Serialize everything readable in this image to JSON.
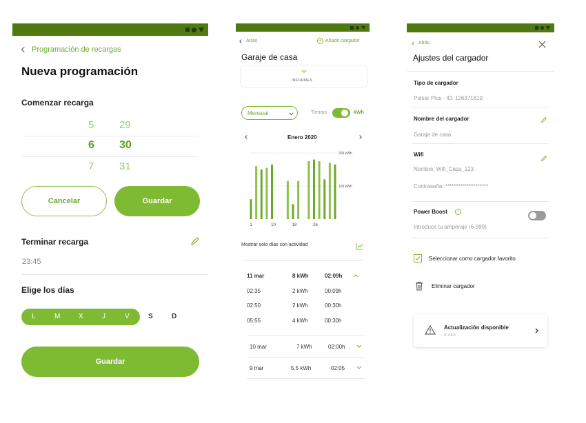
{
  "screen1": {
    "back_label": "Programación de recargas",
    "title": "Nueva programación",
    "start_label": "Comenzar recarga",
    "picker": {
      "hours": [
        "5",
        "6",
        "7"
      ],
      "minutes": [
        "29",
        "30",
        "31"
      ]
    },
    "cancel_label": "Cancelar",
    "save_label": "Guardar",
    "end_label": "Terminar recarga",
    "end_time": "23:45",
    "days_label": "Elige los días",
    "days": [
      "L",
      "M",
      "X",
      "J",
      "V",
      "S",
      "D"
    ],
    "days_selected": [
      "L",
      "M",
      "X",
      "J",
      "V"
    ],
    "save_bottom_label": "Guardar"
  },
  "screen2": {
    "back_label": "Atrás",
    "add_label": "Añadir cargador",
    "title": "Garaje de casa",
    "reports_label": "INFORMES",
    "period_select": "Mensual",
    "toggle_left": "Tiempo",
    "toggle_right": "kWh",
    "month_label": "Enero 2020",
    "chart_data": {
      "type": "bar",
      "x_ticks": [
        "1",
        "10",
        "18",
        "26"
      ],
      "y_ticks": [
        "200 kWh",
        "100 kWh"
      ],
      "ylim": [
        0,
        200
      ],
      "series": [
        {
          "values": [
            60,
            160,
            150,
            155,
            165,
            0,
            0,
            115,
            45,
            115,
            0,
            175,
            180,
            175,
            120,
            170,
            165
          ]
        }
      ]
    },
    "activity_label": "Mostrar solo días con actividad",
    "expanded_day": {
      "date": "11 mar",
      "energy": "8 kWh",
      "time": "02:09h"
    },
    "sessions": [
      {
        "start": "02:35",
        "energy": "2 kWh",
        "duration": "00:09h"
      },
      {
        "start": "02:50",
        "energy": "2 kWh",
        "duration": "00:30h"
      },
      {
        "start": "05:55",
        "energy": "4 kWh",
        "duration": "00:30h"
      }
    ],
    "collapsed_days": [
      {
        "date": "10 mar",
        "energy": "7 kWh",
        "time": "02:00h"
      },
      {
        "date": "9 mar",
        "energy": "5.5 kWh",
        "time": "02:05"
      }
    ]
  },
  "screen3": {
    "back_label": "Atrás",
    "title": "Ajustes del cargador",
    "type_label": "Tipo de cargador",
    "type_value": "Pulsar Plus - ID: 126371819",
    "name_label": "Nombre del cargador",
    "name_value": "Garaje de casa",
    "wifi_label": "Wifi",
    "wifi_name": "Nombre: Wifi_Casa_123",
    "wifi_password": "Contraseña: ********************",
    "boost_label": "Power Boost",
    "boost_hint": "Introduce tu amperaje (6-999)",
    "favorite_label": "Seleccionar como cargador favorito",
    "delete_label": "Eliminar cargador",
    "update_title": "Actualización disponible",
    "update_version": "V. 4.5.5"
  },
  "colors": {
    "statusbar": "#4f7a12",
    "accent": "#7fba33",
    "accent_text": "#6aa92a"
  }
}
